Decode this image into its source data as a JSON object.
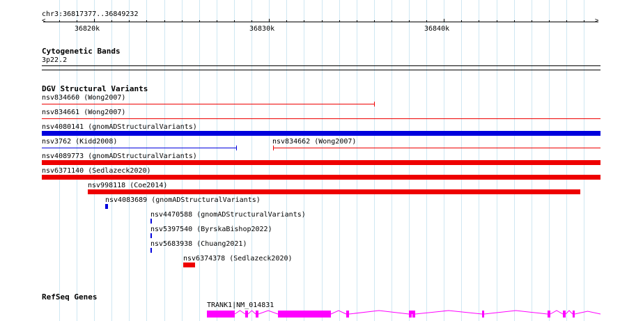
{
  "colors": {
    "grid": "#cfe7f2",
    "red": "#ee0000",
    "blue": "#0000dd",
    "gene": "#ff00ff"
  },
  "ruler": {
    "coordinates": "chr3:36817377..36849232",
    "ticks": [
      "36820k",
      "36830k",
      "36840k"
    ]
  },
  "cytoband": {
    "title": "Cytogenetic Bands",
    "band": "3p22.2"
  },
  "dgv": {
    "title": "DGV Structural Variants",
    "features": [
      {
        "label": "nsv834660 (Wong2007)",
        "color": "red",
        "style": "line"
      },
      {
        "label": "nsv834661 (Wong2007)",
        "color": "red",
        "style": "line"
      },
      {
        "label": "nsv4080141 (gnomADStructuralVariants)",
        "color": "blue",
        "style": "thick"
      },
      {
        "label": "nsv3762 (Kidd2008)",
        "color": "blue",
        "style": "line"
      },
      {
        "label": "nsv834662 (Wong2007)",
        "color": "red",
        "style": "line"
      },
      {
        "label": "nsv4089773 (gnomADStructuralVariants)",
        "color": "red",
        "style": "thick"
      },
      {
        "label": "nsv6371140 (Sedlazeck2020)",
        "color": "red",
        "style": "thick"
      },
      {
        "label": "nsv998118 (Coe2014)",
        "color": "red",
        "style": "thick"
      },
      {
        "label": "nsv4083689 (gnomADStructuralVariants)",
        "color": "blue",
        "style": "thick"
      },
      {
        "label": "nsv4470588 (gnomADStructuralVariants)",
        "color": "blue",
        "style": "thick"
      },
      {
        "label": "nsv5397540 (ByrskaBishop2022)",
        "color": "blue",
        "style": "thick"
      },
      {
        "label": "nsv5683938 (Chuang2021)",
        "color": "blue",
        "style": "thick"
      },
      {
        "label": "nsv6374378 (Sedlazeck2020)",
        "color": "red",
        "style": "thick"
      }
    ]
  },
  "refseq": {
    "title": "RefSeq Genes",
    "gene_label": "TRANK1|NM_014831"
  }
}
